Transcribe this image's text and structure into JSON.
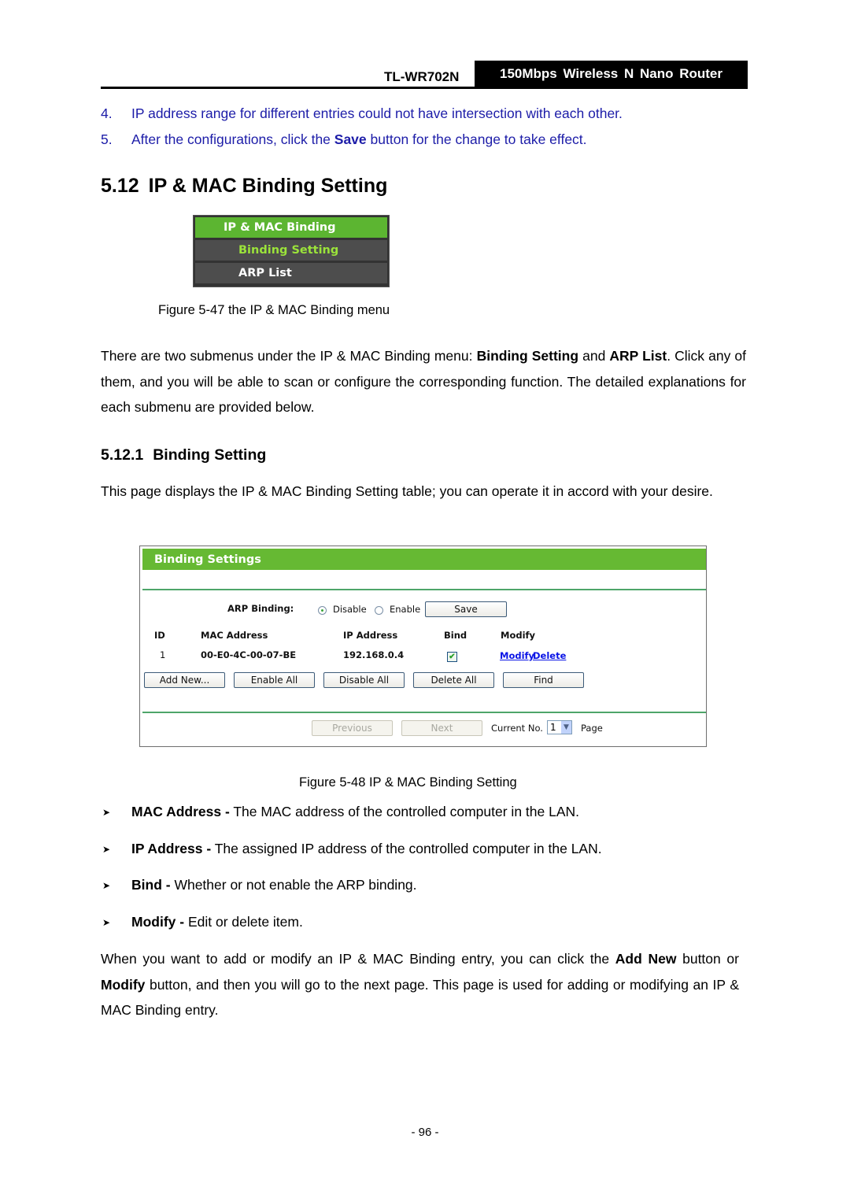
{
  "header": {
    "model": "TL-WR702N",
    "product": "150Mbps Wireless N Nano Router"
  },
  "numbered_items": [
    {
      "num": "4.",
      "text": "IP address range for different entries could not have intersection with each other."
    },
    {
      "num": "5.",
      "text_before": "After the configurations, click the ",
      "bold": "Save",
      "text_after": " button for the change to take effect."
    }
  ],
  "section": {
    "number": "5.12",
    "title": "IP & MAC Binding Setting"
  },
  "menu_figure": {
    "items": [
      "IP & MAC Binding",
      "Binding Setting",
      "ARP List"
    ],
    "caption": "Figure 5-47 the IP & MAC Binding menu",
    "colors": {
      "header": "#5cb531",
      "item_bg": "#4d4d4d",
      "active_text": "#9be33a"
    }
  },
  "intro_para": {
    "p1": "There are two submenus under the IP & MAC Binding menu: ",
    "b1": "Binding Setting",
    "p2": " and ",
    "b2": "ARP List",
    "p3": ". Click any of them, and you will be able to scan or configure the corresponding function. The detailed explanations for each submenu are provided below."
  },
  "subsection": {
    "number": "5.12.1",
    "title": "Binding Setting",
    "description": "This page displays the IP & MAC Binding Setting table; you can operate it in accord with your desire."
  },
  "binding_panel": {
    "title": "Binding Settings",
    "arp_binding_label": "ARP Binding:",
    "radio_options": [
      {
        "label": "Disable",
        "selected": true
      },
      {
        "label": "Enable",
        "selected": false
      }
    ],
    "save_label": "Save",
    "columns": [
      "ID",
      "MAC Address",
      "IP Address",
      "Bind",
      "Modify"
    ],
    "rows": [
      {
        "id": "1",
        "mac": "00-E0-4C-00-07-BE",
        "ip": "192.168.0.4",
        "bind": true,
        "modify": "Modify",
        "delete": "Delete"
      }
    ],
    "buttons": [
      "Add New...",
      "Enable All",
      "Disable All",
      "Delete All",
      "Find"
    ],
    "pagination": {
      "previous": "Previous",
      "next": "Next",
      "current_label": "Current No.",
      "current_value": "1",
      "page_label": "Page"
    },
    "colors": {
      "title_bg": "#66b933",
      "divider": "#4ea56a",
      "link": "#0a14e6"
    }
  },
  "figure2_caption": "Figure 5-48 IP & MAC Binding Setting",
  "bullets": [
    {
      "term": "MAC Address -",
      "text": " The MAC address of the controlled computer in the LAN."
    },
    {
      "term": "IP Address -",
      "text": " The assigned IP address of the controlled computer in the LAN."
    },
    {
      "term": "Bind -",
      "text": " Whether or not enable the ARP binding."
    },
    {
      "term": "Modify -",
      "text": " Edit or delete item."
    }
  ],
  "closing_para": {
    "p1": "When you want to add or modify an IP & MAC Binding entry, you can click the ",
    "b1": "Add New",
    "p2": " button or ",
    "b2": "Modify",
    "p3": " button, and then you will go to the next page. This page is used for adding or modifying an IP & MAC Binding entry."
  },
  "page_number": "- 96 -"
}
